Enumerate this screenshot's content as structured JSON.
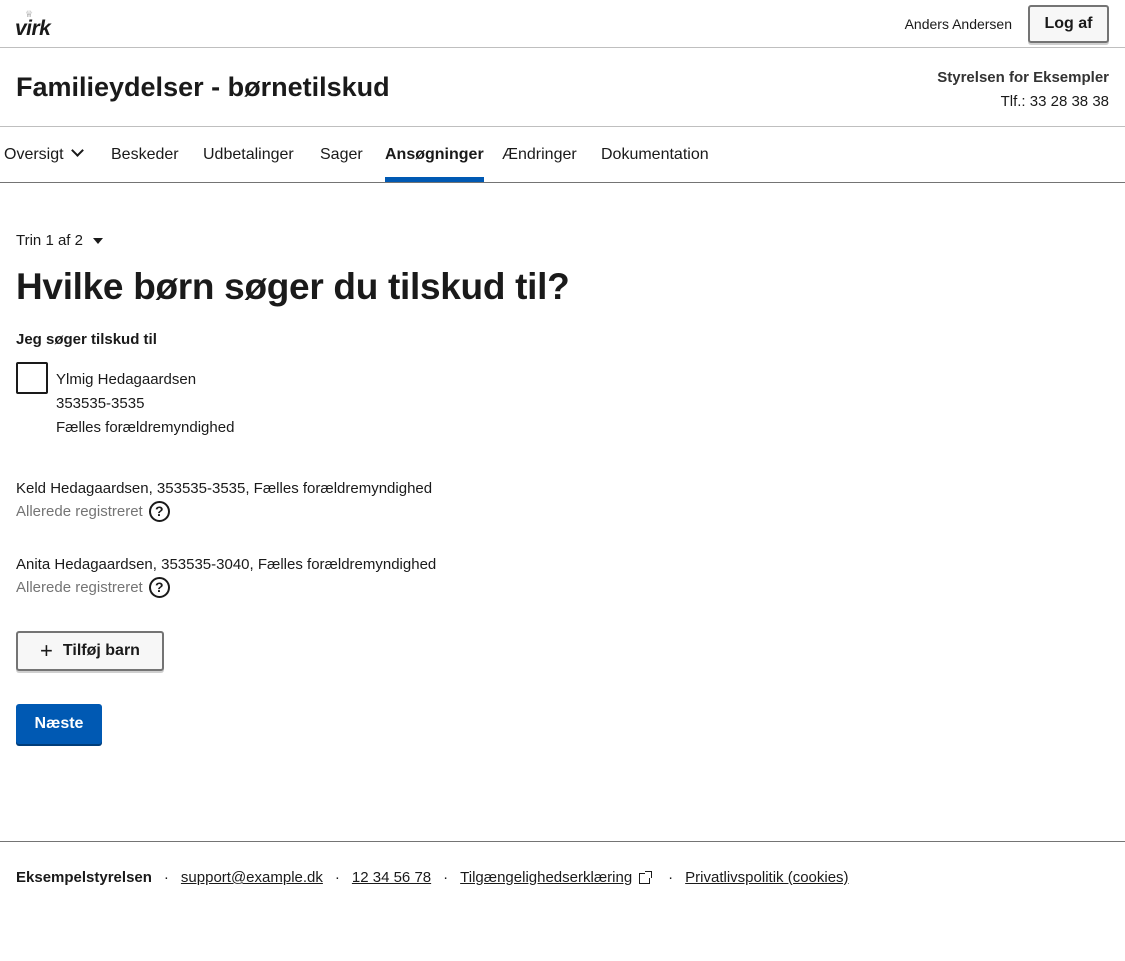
{
  "brand": {
    "logo_text": "virk",
    "logo_crown": "♕"
  },
  "user": {
    "name": "Anders Andersen",
    "logout_label": "Log af"
  },
  "header": {
    "title": "Familieydelser - børnetilskud",
    "authority_name": "Styrelsen for Eksempler",
    "authority_phone": "Tlf.: 33 28 38 38"
  },
  "nav": {
    "items": [
      {
        "label": "Oversigt",
        "has_dropdown": true
      },
      {
        "label": "Beskeder"
      },
      {
        "label": "Udbetalinger"
      },
      {
        "label": "Sager"
      },
      {
        "label": "Ansøgninger",
        "active": true
      },
      {
        "label": "Ændringer"
      },
      {
        "label": "Dokumentation"
      }
    ]
  },
  "main": {
    "step_label": "Trin 1 af 2",
    "title": "Hvilke børn søger du tilskud til?",
    "legend": "Jeg søger tilskud til",
    "selectable_child": {
      "name": "Ylmig Hedagaardsen",
      "cpr": "353535-3535",
      "custody": "Fælles forældremyndighed",
      "checked": false
    },
    "registered_children": [
      {
        "text": "Keld Hedagaardsen, 353535-3535, Fælles forældremyndighed",
        "status": "Allerede registreret"
      },
      {
        "text": "Anita Hedagaardsen, 353535-3040, Fælles forældremyndighed",
        "status": "Allerede registreret"
      }
    ],
    "help_icon_glyph": "?",
    "add_child_label": "Tilføj barn",
    "plus_glyph": "+",
    "next_label": "Næste"
  },
  "footer": {
    "org": "Eksempelstyrelsen",
    "separator": "·",
    "email": "support@example.dk",
    "phone": "12 34 56 78",
    "accessibility": "Tilgængelighedserklæring",
    "privacy": "Privatlivspolitik (cookies)"
  },
  "colors": {
    "primary": "#0059b3",
    "text": "#1a1a1a",
    "muted": "#747474",
    "border": "#bfbfbf"
  }
}
